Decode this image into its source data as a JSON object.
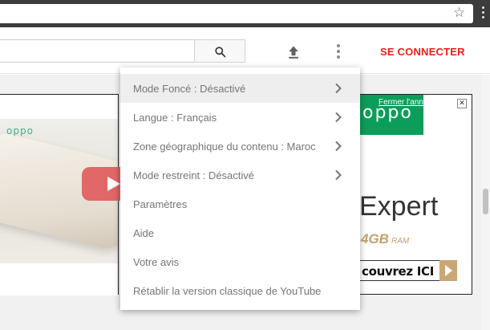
{
  "browser": {
    "icons": {
      "bookmark": "star-icon",
      "menu": "kebab-icon"
    }
  },
  "masthead": {
    "search": {
      "value": "",
      "placeholder": ""
    },
    "signin_label": "SE CONNECTER",
    "signin_color": "#e62117",
    "icons": {
      "search": "search-icon",
      "upload": "upload-icon",
      "settings": "more-vert-icon"
    }
  },
  "ad": {
    "brand_left": "oppo",
    "brand_right": "oppo",
    "close_label": "Fermer l'annonce",
    "close_x": "✕",
    "headline": "Expert",
    "spec_value": "4GB",
    "spec_unit": "RAM",
    "cta": "couvrez ICI",
    "brand_color": "#0a9e5a"
  },
  "menu": {
    "items": [
      {
        "label": "Mode Foncé : Désactivé",
        "has_submenu": true,
        "highlighted": true
      },
      {
        "label": "Langue : Français",
        "has_submenu": true
      },
      {
        "label": "Zone géographique du contenu : Maroc",
        "has_submenu": true
      },
      {
        "label": "Mode restreint : Désactivé",
        "has_submenu": true
      },
      {
        "label": "Paramètres",
        "has_submenu": false
      },
      {
        "label": "Aide",
        "has_submenu": false
      },
      {
        "label": "Votre avis",
        "has_submenu": false
      },
      {
        "label": "Rétablir la version classique de YouTube",
        "has_submenu": false
      }
    ]
  }
}
